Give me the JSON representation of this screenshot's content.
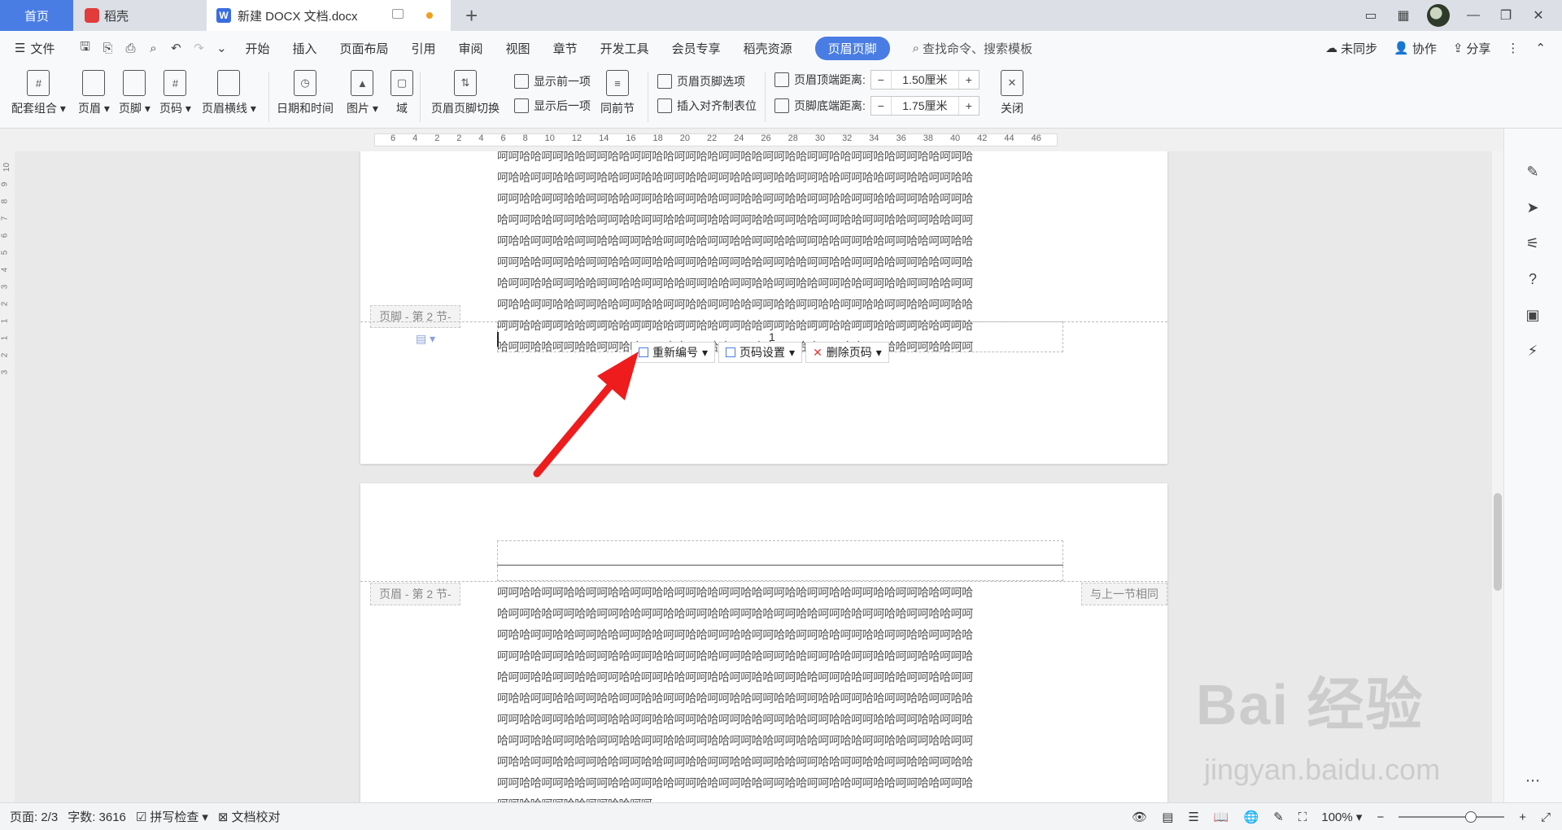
{
  "tabs": {
    "home": "首页",
    "daoke": "稻壳",
    "doc": "新建 DOCX 文档.docx",
    "add": "+"
  },
  "menu": {
    "file": "文件",
    "items": [
      "开始",
      "插入",
      "页面布局",
      "引用",
      "审阅",
      "视图",
      "章节",
      "开发工具",
      "会员专享",
      "稻壳资源"
    ],
    "active": "页眉页脚",
    "search": "查找命令、搜索模板",
    "sync": "未同步",
    "collab": "协作",
    "share": "分享"
  },
  "ribbon": {
    "combo": "配套组合",
    "header": "页眉",
    "footer": "页脚",
    "pagenum": "页码",
    "header_line": "页眉横线",
    "datetime": "日期和时间",
    "picture": "图片",
    "field": "域",
    "switch": "页眉页脚切换",
    "show_prev": "显示前一项",
    "show_next": "显示后一项",
    "same_prev": "同前节",
    "hf_options": "页眉页脚选项",
    "insert_align": "插入对齐制表位",
    "header_top_label": "页眉顶端距离:",
    "header_top_value": "1.50厘米",
    "footer_bottom_label": "页脚底端距离:",
    "footer_bottom_value": "1.75厘米",
    "close": "关闭"
  },
  "ruler": {
    "h": [
      "6",
      "4",
      "2",
      "2",
      "4",
      "6",
      "8",
      "10",
      "12",
      "14",
      "16",
      "18",
      "20",
      "22",
      "24",
      "26",
      "28",
      "30",
      "32",
      "34",
      "36",
      "38",
      "40",
      "42",
      "44",
      "46"
    ],
    "v": [
      "10",
      "9",
      "8",
      "7",
      "6",
      "5",
      "4",
      "3",
      "2",
      "1",
      "1",
      "2",
      "3"
    ]
  },
  "page1": {
    "lines": [
      "呵呵哈哈呵呵哈哈呵呵哈哈呵呵哈哈呵呵哈哈呵呵哈哈呵呵哈哈呵呵哈哈呵呵哈哈呵呵哈哈呵呵哈",
      "呵哈哈呵呵哈哈呵呵哈哈呵呵哈哈呵呵哈哈呵呵哈哈呵呵哈哈呵呵哈哈呵呵哈哈呵呵哈哈呵呵哈哈",
      "呵呵哈哈呵呵哈哈呵呵哈哈呵呵哈哈呵呵哈哈呵呵哈哈呵呵哈哈呵呵哈哈呵呵哈哈呵呵哈哈呵呵哈",
      "哈呵呵哈哈呵呵哈哈呵呵哈哈呵呵哈哈呵呵哈哈呵呵哈哈呵呵哈哈呵呵哈哈呵呵哈哈呵呵哈哈呵呵",
      "呵哈哈呵呵哈哈呵呵哈哈呵呵哈哈呵呵哈哈呵呵哈哈呵呵哈哈呵呵哈哈呵呵哈哈呵呵哈哈呵呵哈哈",
      "呵呵哈哈呵呵哈哈呵呵哈哈呵呵哈哈呵呵哈哈呵呵哈哈呵呵哈哈呵呵哈哈呵呵哈哈呵呵哈哈呵呵哈",
      "哈呵呵哈哈呵呵哈哈呵呵哈哈呵呵哈哈呵呵哈哈呵呵哈哈呵呵哈哈呵呵哈哈呵呵哈哈呵呵哈哈呵呵",
      "呵哈哈呵呵哈哈呵呵哈哈呵呵哈哈呵呵哈哈呵呵哈哈呵呵哈哈呵呵哈哈呵呵哈哈呵呵哈哈呵呵哈哈",
      "呵呵哈哈呵呵哈哈呵呵哈哈呵呵哈哈呵呵哈哈呵呵哈哈呵呵哈哈呵呵哈哈呵呵哈哈呵呵哈哈呵呵哈",
      "哈呵呵哈哈呵呵哈哈呵呵哈哈呵呵哈哈呵呵哈哈呵呵哈哈呵呵哈哈呵呵哈哈呵呵哈哈呵呵哈哈呵呵"
    ],
    "footer_tag": "页脚  - 第 2 节-",
    "page_number": "1"
  },
  "footer_toolbar": {
    "renumber": "重新编号",
    "pagenum_settings": "页码设置",
    "delete_pagenum": "删除页码"
  },
  "page2": {
    "header_tag": "页眉  - 第 2 节-",
    "same_as_prev": "与上一节相同",
    "lines": [
      "呵呵哈哈呵呵哈哈呵呵哈哈呵呵哈哈呵呵哈哈呵呵哈哈呵呵哈哈呵呵哈哈呵呵哈哈呵呵哈哈呵呵哈",
      "哈呵呵哈哈呵呵哈哈呵呵哈哈呵呵哈哈呵呵哈哈呵呵哈哈呵呵哈哈呵呵哈哈呵呵哈哈呵呵哈哈呵呵",
      "呵哈哈呵呵哈哈呵呵哈哈呵呵哈哈呵呵哈哈呵呵哈哈呵呵哈哈呵呵哈哈呵呵哈哈呵呵哈哈呵呵哈哈",
      "呵呵哈哈呵呵哈哈呵呵哈哈呵呵哈哈呵呵哈哈呵呵哈哈呵呵哈哈呵呵哈哈呵呵哈哈呵呵哈哈呵呵哈",
      "哈呵呵哈哈呵呵哈哈呵呵哈哈呵呵哈哈呵呵哈哈呵呵哈哈呵呵哈哈呵呵哈哈呵呵哈哈呵呵哈哈呵呵",
      "呵哈哈呵呵哈哈呵呵哈哈呵呵哈哈呵呵哈哈呵呵哈哈呵呵哈哈呵呵哈哈呵呵哈哈呵呵哈哈呵呵哈哈",
      "呵呵哈哈呵呵哈哈呵呵哈哈呵呵哈哈呵呵哈哈呵呵哈哈呵呵哈哈呵呵哈哈呵呵哈哈呵呵哈哈呵呵哈",
      "哈呵呵哈哈呵呵哈哈呵呵哈哈呵呵哈哈呵呵哈哈呵呵哈哈呵呵哈哈呵呵哈哈呵呵哈哈呵呵哈哈呵呵",
      "呵哈哈呵呵哈哈呵呵哈哈呵呵哈哈呵呵哈哈呵呵哈哈呵呵哈哈呵呵哈哈呵呵哈哈呵呵哈哈呵呵哈哈",
      "呵呵哈哈呵呵哈哈呵呵哈哈呵呵哈哈呵呵哈哈呵呵哈哈呵呵哈哈呵呵哈哈呵呵哈哈呵呵哈哈呵呵哈",
      "呵呵哈哈呵呵哈哈呵呵哈哈呵呵"
    ]
  },
  "status": {
    "page": "页面: 2/3",
    "words": "字数: 3616",
    "spell": "拼写检查",
    "proof": "文档校对",
    "zoom": "100%"
  },
  "watermark": {
    "brand": "Bai 经验",
    "url": "jingyan.baidu.com"
  },
  "colors": {
    "accent": "#4a7de4",
    "arrow": "#ee1c1c"
  }
}
